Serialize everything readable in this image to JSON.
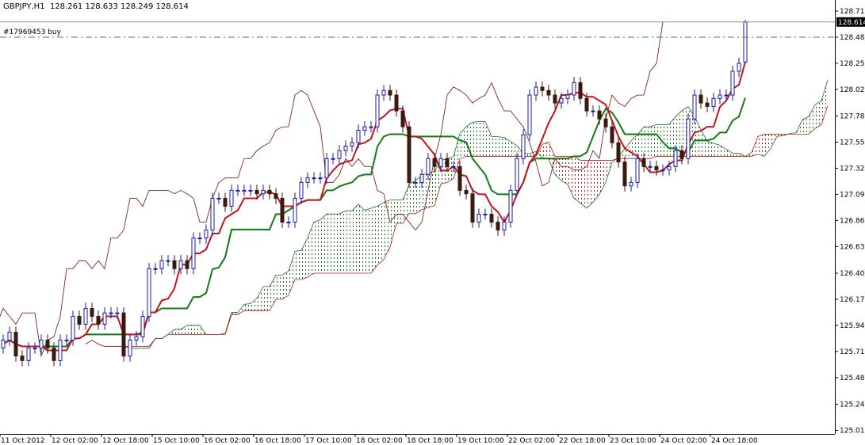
{
  "header": {
    "symbol": "GBPJPY,H1",
    "ohlc": "128.261 128.633 128.249 128.614"
  },
  "order_line": {
    "label": "#17969453 buy",
    "price": 128.48
  },
  "current_price": {
    "label": "128.614",
    "value": 128.614
  },
  "colors": {
    "bull_candle": "#1a1aa8",
    "bear_candle": "#3a1a10",
    "tenkan": "#c0141e",
    "kijun": "#137a13",
    "chikou": "#7a2a20",
    "cloud_up": "#1f6e1f",
    "cloud_down": "#b02020",
    "order_line": "#3a8a3a"
  },
  "chart_data": {
    "type": "candlestick",
    "title": "GBPJPY,H1",
    "indicator": "Ichimoku Kinko Hyo",
    "ylim": [
      125.0,
      128.72
    ],
    "y_ticks": [
      "128.710",
      "128.480",
      "128.250",
      "128.020",
      "127.785",
      "127.555",
      "127.325",
      "127.095",
      "126.865",
      "126.635",
      "126.400",
      "126.170",
      "125.940",
      "125.710",
      "125.480",
      "125.245",
      "125.015"
    ],
    "x_ticks": [
      "11 Oct 2012",
      "12 Oct 02:00",
      "12 Oct 18:00",
      "15 Oct 10:00",
      "16 Oct 02:00",
      "16 Oct 18:00",
      "17 Oct 10:00",
      "18 Oct 02:00",
      "18 Oct 18:00",
      "19 Oct 10:00",
      "22 Oct 02:00",
      "22 Oct 18:00",
      "23 Oct 10:00",
      "24 Oct 02:00",
      "24 Oct 18:00"
    ],
    "first_open": 125.74,
    "wick": 0.05,
    "last_bar": {
      "open": 128.261,
      "high": 128.633,
      "low": 128.249,
      "close": 128.614
    },
    "closes": [
      125.81,
      125.88,
      125.67,
      125.63,
      125.74,
      125.74,
      125.81,
      125.74,
      125.63,
      125.81,
      125.81,
      126.02,
      125.95,
      126.09,
      126.02,
      125.95,
      126.05,
      126.05,
      126.05,
      125.67,
      125.81,
      125.84,
      126.02,
      126.44,
      126.44,
      126.51,
      126.51,
      126.44,
      126.51,
      126.44,
      126.71,
      126.71,
      126.78,
      127.06,
      127.06,
      126.99,
      127.13,
      127.13,
      127.13,
      127.13,
      127.1,
      127.13,
      127.1,
      127.06,
      126.85,
      126.85,
      127.06,
      127.2,
      127.24,
      127.24,
      127.24,
      127.41,
      127.41,
      127.48,
      127.52,
      127.55,
      127.66,
      127.69,
      127.69,
      127.97,
      128.01,
      127.97,
      127.83,
      127.69,
      127.2,
      127.2,
      127.27,
      127.41,
      127.34,
      127.41,
      127.34,
      127.34,
      127.13,
      127.1,
      126.85,
      126.92,
      126.92,
      126.85,
      126.78,
      126.85,
      127.13,
      127.41,
      127.62,
      127.97,
      128.04,
      128.01,
      127.97,
      127.9,
      127.94,
      127.97,
      128.08,
      127.94,
      127.83,
      127.83,
      127.76,
      127.69,
      127.55,
      127.38,
      127.17,
      127.2,
      127.41,
      127.34,
      127.34,
      127.31,
      127.31,
      127.34,
      127.48,
      127.41,
      127.76,
      127.97,
      127.9,
      127.87,
      127.94,
      127.97,
      127.97,
      128.18,
      128.25,
      128.614
    ],
    "ichimoku_periods": {
      "tenkan": 5,
      "kijun": 13,
      "senkou_b": 26,
      "shift": 13
    }
  }
}
